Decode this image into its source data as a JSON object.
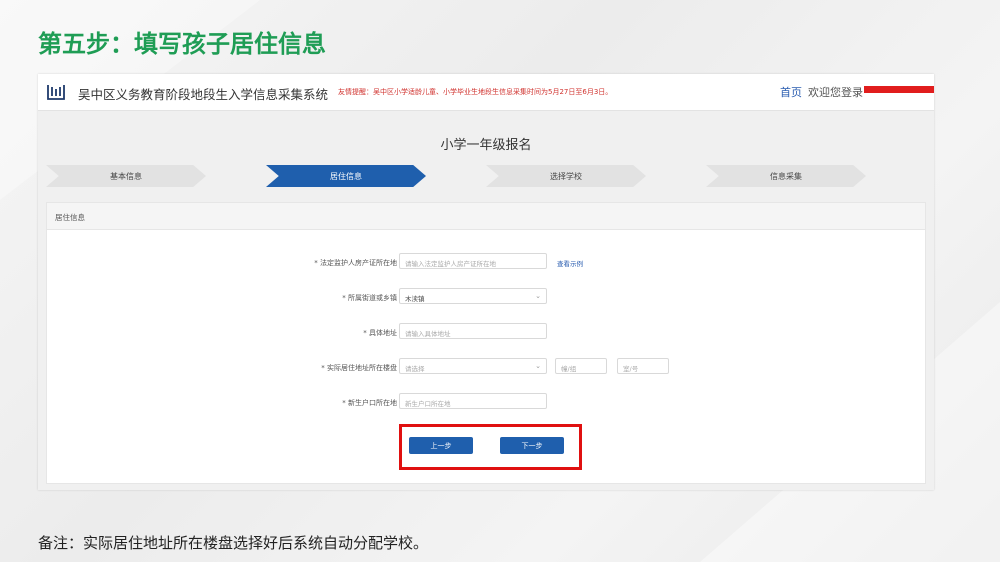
{
  "slide": {
    "title": "第五步：填写孩子居住信息",
    "note": "备注：实际居住地址所在楼盘选择好后系统自动分配学校。"
  },
  "header": {
    "system_name": "吴中区义务教育阶段地段生入学信息采集系统",
    "notice": "友情提醒：吴中区小学适龄儿童、小学毕业生地段生信息采集时间为5月27日至6月3日。",
    "home_link": "首页",
    "welcome": "欢迎您登录"
  },
  "form": {
    "title": "小学一年级报名",
    "steps": [
      {
        "label": "基本信息",
        "active": false
      },
      {
        "label": "居住信息",
        "active": true
      },
      {
        "label": "选择学校",
        "active": false
      },
      {
        "label": "信息采集",
        "active": false
      }
    ],
    "panel_title": "居住信息",
    "fields": {
      "guardian_property": {
        "label": "* 法定监护人房产证所在地",
        "placeholder": "请输入法定监护人房产证所在地",
        "link": "查看示例"
      },
      "street_town": {
        "label": "* 所属街道或乡镇",
        "value": "木渎镇"
      },
      "address": {
        "label": "* 具体地址",
        "placeholder": "请输入具体地址"
      },
      "estate": {
        "label": "* 实际居住地址所在楼盘",
        "placeholder": "请选择",
        "building_placeholder": "幢/组",
        "room_placeholder": "室/号"
      },
      "household": {
        "label": "* 新生户口所在地",
        "placeholder": "新生户口所在地"
      }
    },
    "buttons": {
      "prev": "上一步",
      "next": "下一步"
    }
  },
  "colors": {
    "title_green": "#1f9d55",
    "primary_blue": "#1f5fad",
    "highlight_red": "#e01010"
  }
}
